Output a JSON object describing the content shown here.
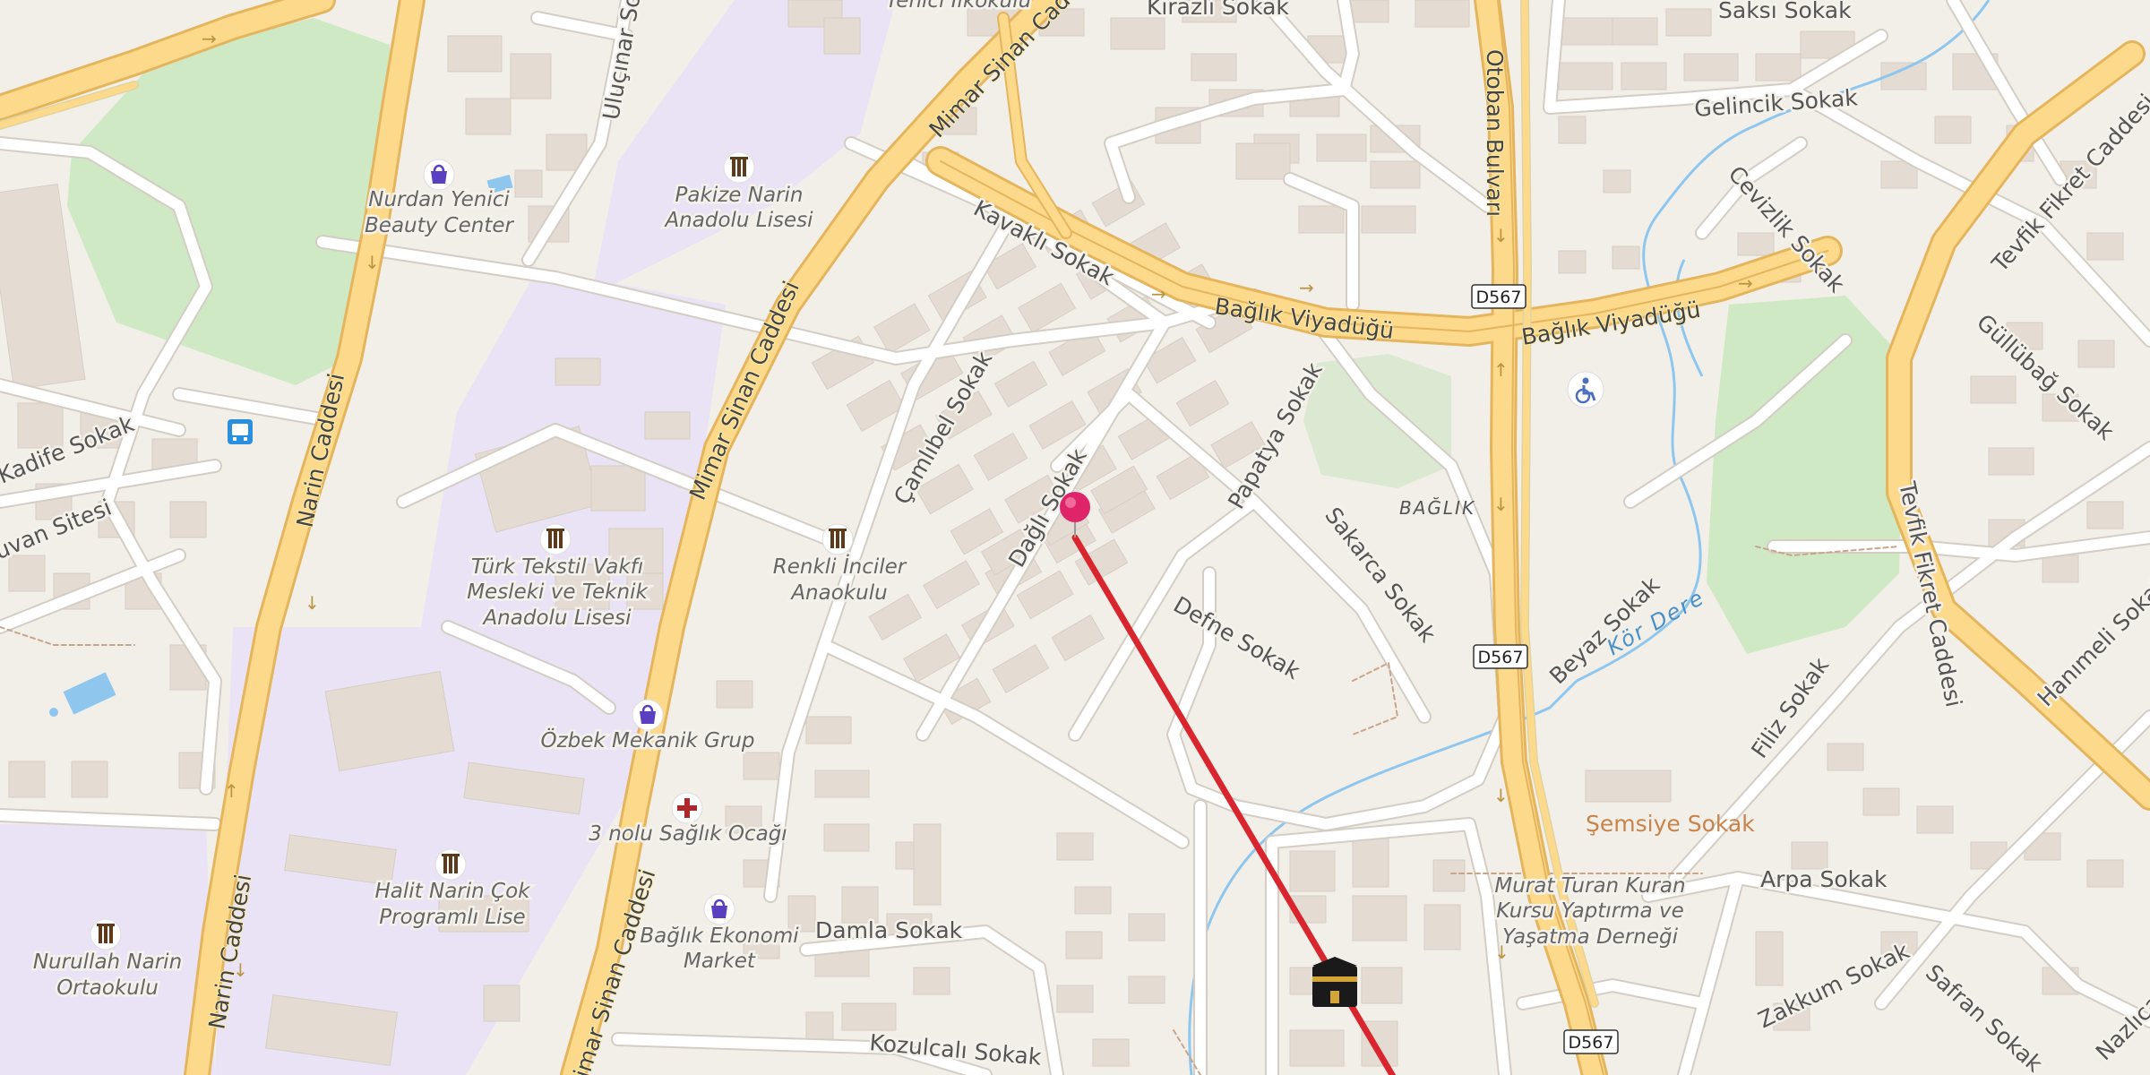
{
  "map": {
    "streets": {
      "mimar_sinan_1": "Mimar Sinan Caddesi",
      "mimar_sinan_2": "Mimar Sinan Caddesi",
      "mimar_sinan_3": "Mimar Sinan Caddesi",
      "narin_1": "Narin Caddesi",
      "narin_2": "Narin Caddesi",
      "kirazli": "Kirazlı Sokak",
      "kavakli": "Kavaklı Sokak",
      "baglik_viy_1": "Bağlık Viyadüğü",
      "baglik_viy_2": "Bağlık Viyadüğü",
      "otoban": "Otoban Bulvarı",
      "saksi": "Saksı Sokak",
      "gelincik": "Gelincik Sokak",
      "cevizlik": "Cevizlik Sokak",
      "tevfik_1": "Tevfik Fikret Caddesi",
      "tevfik_2": "Tevfik Fikret Caddesi",
      "gullubag": "Güllübağ Sokak",
      "ulucinar": "Uluçınar Sokak",
      "kadife": "Kadife Sokak",
      "erguvan": "Erguvan Sitesi",
      "camlibel": "Çamlıbel Sokak",
      "dagli": "Dağlı Sokak",
      "papatya": "Papatya Sokak",
      "sakarca": "Sakarca Sokak",
      "defne": "Defne Sokak",
      "beyaz": "Beyaz Sokak",
      "filiz": "Filiz Sokak",
      "hanimeli": "Hanımeli Sokak",
      "semsiye": "Şemsiye Sokak",
      "arpa": "Arpa Sokak",
      "zakkum": "Zakkum Sokak",
      "safran": "Safran Sokak",
      "nazli": "Nazlıca",
      "damla": "Damla Sokak",
      "kozulcali": "Kozulcalı Sokak"
    },
    "water": {
      "kor_dere": "Kör Dere"
    },
    "places": {
      "baglik": "BAĞLIK"
    },
    "road_shields": [
      "D567",
      "D567",
      "D567"
    ],
    "pois": [
      {
        "id": "nurdan",
        "line1": "Nurdan Yenici",
        "line2": "Beauty Center",
        "icon": "shopping-bag-icon"
      },
      {
        "id": "pakize",
        "line1": "Pakize Narin",
        "line2": "Anadolu Lisesi",
        "icon": "school-icon"
      },
      {
        "id": "yenici_top",
        "line1": "Yenici İlkokulu",
        "icon": "school-icon"
      },
      {
        "id": "turk_tekstil",
        "line1": "Türk Tekstil Vakfı",
        "line2": "Mesleki ve Teknik",
        "line3": "Anadolu Lisesi",
        "icon": "school-icon"
      },
      {
        "id": "renkli",
        "line1": "Renkli İnciler",
        "line2": "Anaokulu",
        "icon": "school-icon"
      },
      {
        "id": "ozbek",
        "line1": "Özbek Mekanik Grup",
        "icon": "shopping-bag-icon"
      },
      {
        "id": "saglik",
        "line1": "3 nolu Sağlık Ocağı",
        "icon": "health-cross-icon"
      },
      {
        "id": "halit",
        "line1": "Halit Narin Çok",
        "line2": "Programlı Lise",
        "icon": "school-icon"
      },
      {
        "id": "nurullah",
        "line1": "Nurullah Narin",
        "line2": "Ortaokulu",
        "icon": "school-icon"
      },
      {
        "id": "baglik_ekonomi",
        "line1": "Bağlık Ekonomi",
        "line2": "Market",
        "icon": "shopping-bag-icon"
      },
      {
        "id": "murat_turan",
        "line1": "Murat Turan Kuran",
        "line2": "Kursu Yaptırma ve",
        "line3": "Yaşatma Derneği"
      }
    ],
    "colors": {
      "background": "#f2efe9",
      "building": "#e4dcd2",
      "school_area": "#e9e3f5",
      "park": "#cfe9c4",
      "major_road": "#fcd98b",
      "route_line": "#d9262e",
      "pin": "#e0246a",
      "water": "#8ec6ee"
    },
    "icons": [
      "map-pin-icon",
      "bus-stop-icon",
      "kaaba-icon",
      "wheelchair-icon"
    ]
  }
}
